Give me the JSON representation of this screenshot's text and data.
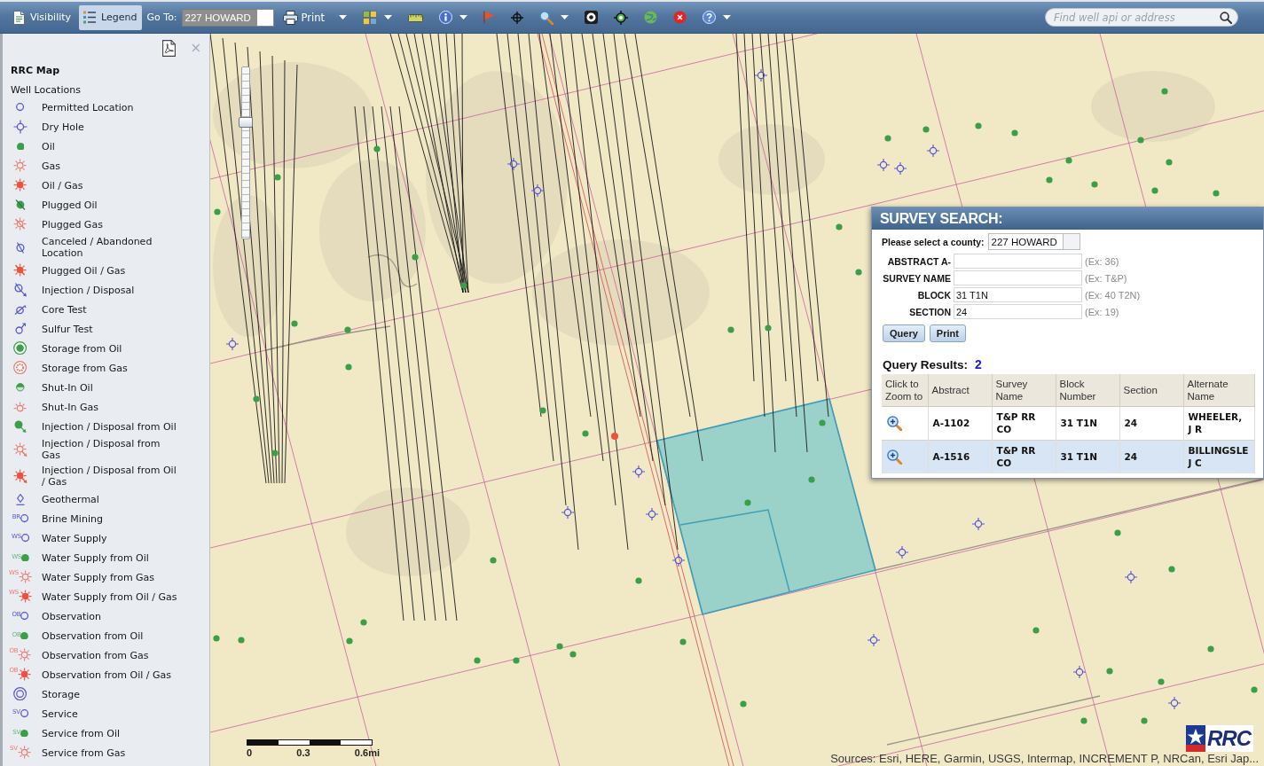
{
  "toolbar": {
    "tabs": [
      {
        "label": "Visibility",
        "selected": false
      },
      {
        "label": "Legend",
        "selected": true
      }
    ],
    "goto": {
      "label": "Go To:",
      "value": "227 HOWARD"
    },
    "print": "Print",
    "search": {
      "placeholder": "Find well api or address"
    }
  },
  "legend": {
    "title": "RRC Map",
    "close": "×",
    "group": "Well Locations",
    "items": [
      {
        "label": "Permitted Location",
        "kind": "permitted"
      },
      {
        "label": "Dry Hole",
        "kind": "dry"
      },
      {
        "label": "Oil",
        "kind": "oil"
      },
      {
        "label": "Gas",
        "kind": "gas"
      },
      {
        "label": "Oil / Gas",
        "kind": "oilgas"
      },
      {
        "label": "Plugged Oil",
        "kind": "pluggedoil"
      },
      {
        "label": "Plugged Gas",
        "kind": "pluggedgas"
      },
      {
        "label": "Canceled / Abandoned Location",
        "kind": "canceled"
      },
      {
        "label": "Plugged Oil / Gas",
        "kind": "pluggedoilgas"
      },
      {
        "label": "Injection / Disposal",
        "kind": "injection"
      },
      {
        "label": "Core Test",
        "kind": "core"
      },
      {
        "label": "Sulfur Test",
        "kind": "sulfur"
      },
      {
        "label": "Storage from Oil",
        "kind": "storageoil"
      },
      {
        "label": "Storage from Gas",
        "kind": "storagegas"
      },
      {
        "label": "Shut-In Oil",
        "kind": "shutinoil"
      },
      {
        "label": "Shut-In Gas",
        "kind": "shutingas"
      },
      {
        "label": "Injection / Disposal from Oil",
        "kind": "injectionoil"
      },
      {
        "label": "Injection / Disposal from Gas",
        "kind": "injectiongas"
      },
      {
        "label": "Injection / Disposal from Oil / Gas",
        "kind": "injectionoilgas"
      },
      {
        "label": "Geothermal",
        "kind": "geothermal"
      },
      {
        "label": "Brine Mining",
        "kind": "permitted",
        "code": "BR"
      },
      {
        "label": "Water Supply",
        "kind": "permitted",
        "code": "WS"
      },
      {
        "label": "Water Supply from Oil",
        "kind": "oil",
        "code": "WS"
      },
      {
        "label": "Water Supply from Gas",
        "kind": "gas",
        "code": "WS"
      },
      {
        "label": "Water Supply from Oil / Gas",
        "kind": "oilgas",
        "code": "WS"
      },
      {
        "label": "Observation",
        "kind": "permitted",
        "code": "OB"
      },
      {
        "label": "Observation from Oil",
        "kind": "oil",
        "code": "OB"
      },
      {
        "label": "Observation from Gas",
        "kind": "gas",
        "code": "OB"
      },
      {
        "label": "Observation from Oil / Gas",
        "kind": "oilgas",
        "code": "OB"
      },
      {
        "label": "Storage",
        "kind": "storage"
      },
      {
        "label": "Service",
        "kind": "permitted",
        "code": "SV"
      },
      {
        "label": "Service from Oil",
        "kind": "oil",
        "code": "SV"
      },
      {
        "label": "Service from Gas",
        "kind": "gas",
        "code": "SV"
      }
    ]
  },
  "map": {
    "zoom_slider": {
      "level": 0.69
    },
    "scale_bar": {
      "labels": [
        "0",
        "0.3",
        "0.6mi"
      ]
    },
    "attribution": "Sources: Esri, HERE, Garmin, USGS, Intermap, INCREMENT P, NRCan, Esri Jap...",
    "logo": {
      "text": "RRC"
    }
  },
  "survey_search": {
    "title": "SURVEY SEARCH:",
    "county": {
      "label": "Please select a county:",
      "value": "227 HOWARD"
    },
    "fields": [
      {
        "label": "ABSTRACT A-",
        "hint": "(Ex: 36)"
      },
      {
        "label": "SURVEY NAME",
        "hint": "(Ex: T&P)"
      },
      {
        "label": "BLOCK",
        "value": "31 T1N",
        "hint": "(Ex: 40 T2N)"
      },
      {
        "label": "SECTION",
        "value": "24",
        "hint": "(Ex: 19)"
      }
    ],
    "buttons": [
      "Query",
      "Print"
    ],
    "results": {
      "label": "Query Results:",
      "count": "2"
    },
    "table": {
      "columns": [
        "Click to Zoom to",
        "Abstract",
        "Survey Name",
        "Block Number",
        "Section",
        "Alternate Name"
      ],
      "rows": [
        {
          "selected": false,
          "cells": [
            "",
            "A-1102",
            "T&P RR CO",
            "31 T1N",
            "24",
            "WHEELER, J R"
          ]
        },
        {
          "selected": true,
          "cells": [
            "",
            "A-1516",
            "T&P RR CO",
            "31 T1N",
            "24",
            "BILLINGSLE J C"
          ]
        }
      ]
    }
  }
}
